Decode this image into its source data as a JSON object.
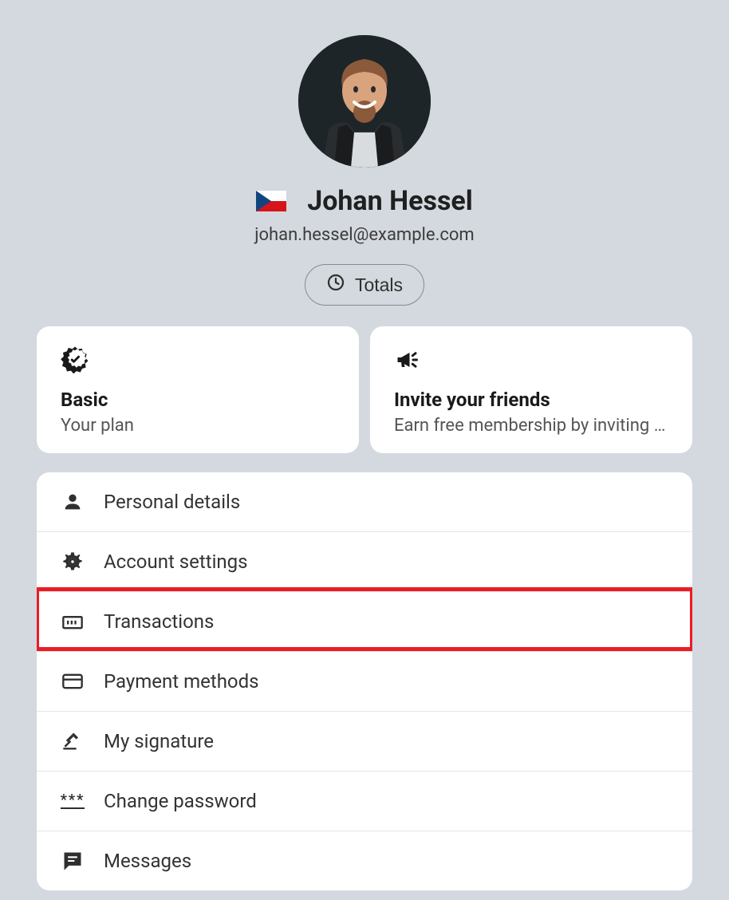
{
  "profile": {
    "name": "Johan Hessel",
    "email": "johan.hessel@example.com",
    "flag": "czech"
  },
  "totals_button": {
    "label": "Totals"
  },
  "cards": {
    "plan": {
      "title": "Basic",
      "subtitle": "Your plan"
    },
    "invite": {
      "title": "Invite your friends",
      "subtitle": "Earn free membership by inviting y..."
    }
  },
  "menu": {
    "personal_details": "Personal details",
    "account_settings": "Account settings",
    "transactions": "Transactions",
    "payment_methods": "Payment methods",
    "my_signature": "My signature",
    "change_password": "Change password",
    "messages": "Messages"
  },
  "highlighted_item": "transactions"
}
